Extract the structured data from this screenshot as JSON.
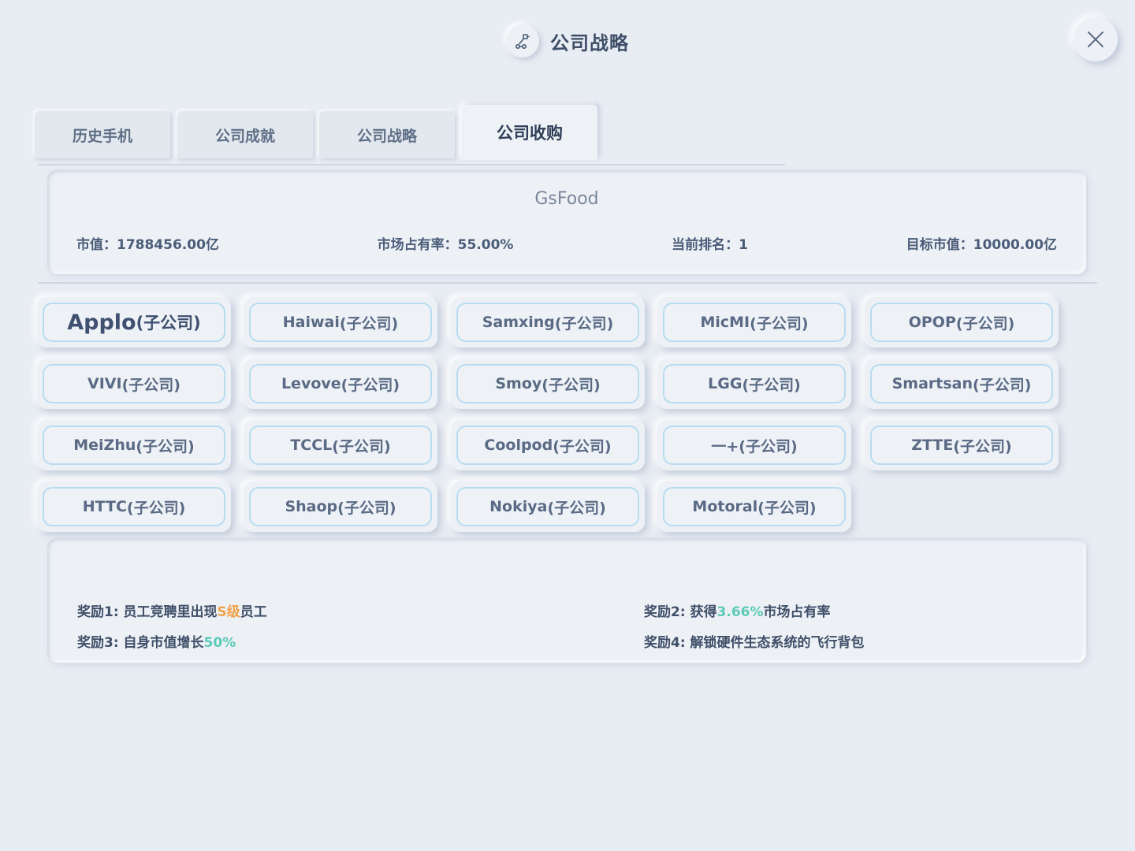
{
  "header": {
    "title": "公司战略",
    "icon": "robot-arm-icon",
    "close_icon": "close-icon"
  },
  "tabs": [
    {
      "label": "历史手机",
      "active": false
    },
    {
      "label": "公司成就",
      "active": false
    },
    {
      "label": "公司战略",
      "active": false
    },
    {
      "label": "公司收购",
      "active": true
    }
  ],
  "company": {
    "name": "GsFood",
    "market_value": "市值：1788456.00亿",
    "market_share": "市场占有率：55.00%",
    "rank": "当前排名：1",
    "target_value": "目标市值：10000.00亿"
  },
  "subsidiaries": [
    {
      "name": "Applo",
      "suffix": "(子公司)"
    },
    {
      "name": "Haiwai",
      "suffix": "(子公司)"
    },
    {
      "name": "Samxing",
      "suffix": "(子公司)"
    },
    {
      "name": "MicMI",
      "suffix": "(子公司)"
    },
    {
      "name": "OPOP",
      "suffix": "(子公司)"
    },
    {
      "name": "VIVI",
      "suffix": "(子公司)"
    },
    {
      "name": "Levove",
      "suffix": "(子公司)"
    },
    {
      "name": "Smoy",
      "suffix": "(子公司)"
    },
    {
      "name": "LGG",
      "suffix": "(子公司)"
    },
    {
      "name": "Smartsan",
      "suffix": "(子公司)"
    },
    {
      "name": "MeiZhu",
      "suffix": "(子公司)"
    },
    {
      "name": "TCCL",
      "suffix": "(子公司)"
    },
    {
      "name": "Coolpod",
      "suffix": "(子公司)"
    },
    {
      "name": "一+",
      "suffix": "(子公司)"
    },
    {
      "name": "ZTTE",
      "suffix": "(子公司)"
    },
    {
      "name": "HTTC",
      "suffix": "(子公司)"
    },
    {
      "name": "Shaop",
      "suffix": "(子公司)"
    },
    {
      "name": "Nokiya",
      "suffix": "(子公司)"
    },
    {
      "name": "Motoral",
      "suffix": "(子公司)"
    }
  ],
  "rewards": {
    "r1": {
      "prefix": "奖励1: 员工竞聘里出现",
      "highlight": "S级",
      "suffix": "员工"
    },
    "r2": {
      "prefix": "奖励2: 获得",
      "highlight": "3.66%",
      "suffix": "市场占有率"
    },
    "r3": {
      "prefix": "奖励3: 自身市值增长",
      "highlight": "50%"
    },
    "r4": {
      "text": "奖励4: 解锁硬件生态系统的飞行背包"
    }
  },
  "colors": {
    "highlight_orange": "#f0a24a",
    "highlight_teal": "#5ccab8",
    "button_border": "#b7dcf0"
  }
}
